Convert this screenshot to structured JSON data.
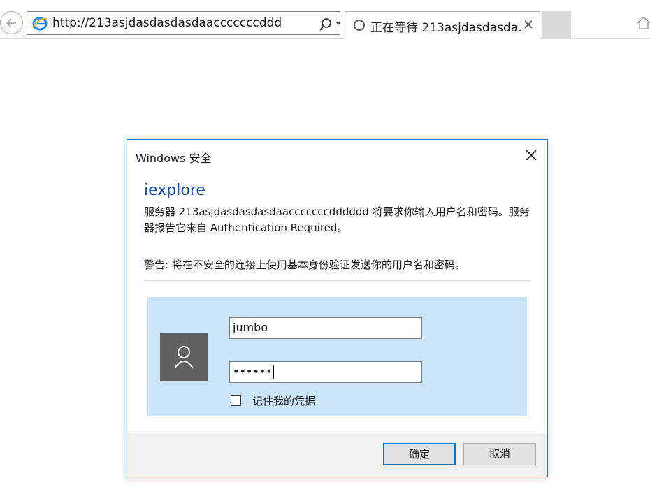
{
  "browser": {
    "address_url": "http://213asjdasdasdasdaacccccccddd...",
    "tab_title": "正在等待 213asjdasdasda...",
    "tab_close": "×"
  },
  "dialog": {
    "title": "Windows 安全",
    "heading": "iexplore",
    "message": "服务器 213asjdasdasdasdaacccccccdddddd 将要求你输入用户名和密码。服务器报告它来自 Authentication Required。",
    "warning": "警告: 将在不安全的连接上使用基本身份验证发送你的用户名和密码。",
    "username_value": "jumbo",
    "password_value": "••••••",
    "remember_label": "记住我的凭据",
    "remember_checked": false,
    "ok_label": "确定",
    "cancel_label": "取消"
  },
  "colors": {
    "dialog_border": "#1979ca",
    "heading": "#1a4fa3",
    "credential_panel": "#cce4f7",
    "avatar": "#606060",
    "default_button_border": "#0078d7"
  },
  "icons": [
    "back-arrow-icon",
    "ie-logo-icon",
    "search-icon",
    "dropdown-icon",
    "stop-icon",
    "loading-icon",
    "home-icon",
    "close-icon",
    "user-icon"
  ]
}
